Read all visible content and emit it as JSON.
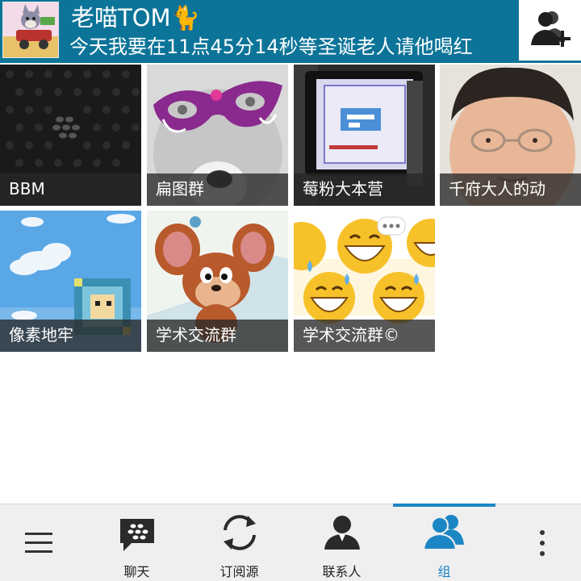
{
  "header": {
    "title": "老喵TOM🐈",
    "status": "今天我要在11点45分14秒等圣诞老人请他喝红",
    "avatar_icon": "tom-cat-avatar-icon",
    "add_contact_icon": "add-contact-icon",
    "accent_color": "#0c7499"
  },
  "groups": [
    {
      "label": "BBM",
      "thumb": "bbm-logo-thumbnail"
    },
    {
      "label": "扁图群",
      "thumb": "masked-husky-thumbnail"
    },
    {
      "label": "莓粉大本营",
      "thumb": "blackberry-device-screen-thumbnail"
    },
    {
      "label": "千府大人的动",
      "thumb": "boy-with-glasses-thumbnail"
    },
    {
      "label": "像素地牢",
      "thumb": "pixel-sky-thumbnail"
    },
    {
      "label": "学术交流群",
      "thumb": "jerry-mouse-thumbnail"
    },
    {
      "label": "学术交流群©",
      "thumb": "sweat-smile-emoji-thumbnail"
    }
  ],
  "nav": {
    "menu_icon": "hamburger-menu-icon",
    "items": [
      {
        "label": "聊天",
        "icon": "bbm-chat-icon"
      },
      {
        "label": "订阅源",
        "icon": "refresh-icon"
      },
      {
        "label": "联系人",
        "icon": "contact-icon"
      },
      {
        "label": "组",
        "icon": "group-icon",
        "active": true
      }
    ],
    "more_icon": "overflow-menu-icon",
    "active_color": "#1b86c4"
  }
}
